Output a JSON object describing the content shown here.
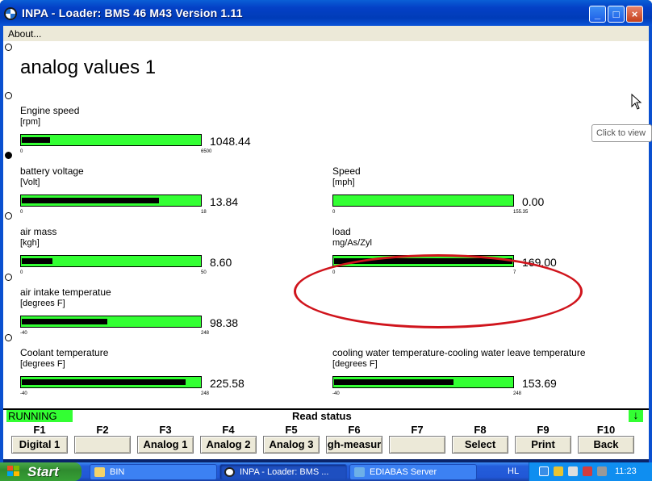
{
  "window": {
    "title": "INPA - Loader:  BMS 46 M43 Version 1.11",
    "minimize": "_",
    "maximize": "□",
    "close": "×"
  },
  "menu": {
    "about": "About..."
  },
  "heading": "analog values 1",
  "gauges": [
    {
      "name": "Engine speed",
      "unit": "[rpm]",
      "value": "1048.44",
      "min": "0",
      "max": "6500",
      "fill": 0.16
    },
    {
      "name": "battery voltage",
      "unit": "[Volt]",
      "value": "13.84",
      "min": "0",
      "max": "18",
      "fill": 0.77
    },
    {
      "name": "Speed",
      "unit": "[mph]",
      "value": "0.00",
      "min": "0",
      "max": "155.35",
      "fill": 0.0
    },
    {
      "name": "air mass",
      "unit": "[kgh]",
      "value": "8.60",
      "min": "0",
      "max": "50",
      "fill": 0.17
    },
    {
      "name": "load",
      "unit": "mg/As/Zyl",
      "value": "169.00",
      "min": "0",
      "max": "7",
      "fill": 1.0
    },
    {
      "name": "air intake temperatue",
      "unit": "[degrees F]",
      "value": "98.38",
      "min": "-40",
      "max": "248",
      "fill": 0.48
    },
    {
      "name": "Coolant temperature",
      "unit": "[degrees F]",
      "value": "225.58",
      "min": "-40",
      "max": "248",
      "fill": 0.92
    },
    {
      "name": "cooling water temperature-cooling water leave temperature",
      "unit": "[degrees F]",
      "value": "153.69",
      "min": "-40",
      "max": "248",
      "fill": 0.67
    }
  ],
  "tooltip": "Click to view",
  "status": {
    "running": "RUNNING",
    "read": "Read status",
    "arrow": "↓",
    "running_color": "#33ff33"
  },
  "fkeys": [
    {
      "key": "F1",
      "label": "Digital 1"
    },
    {
      "key": "F2",
      "label": ""
    },
    {
      "key": "F3",
      "label": "Analog 1"
    },
    {
      "key": "F4",
      "label": "Analog 2"
    },
    {
      "key": "F5",
      "label": "Analog 3"
    },
    {
      "key": "F6",
      "label": "gh-measur"
    },
    {
      "key": "F7",
      "label": ""
    },
    {
      "key": "F8",
      "label": "Select"
    },
    {
      "key": "F9",
      "label": "Print"
    },
    {
      "key": "F10",
      "label": "Back"
    }
  ],
  "taskbar": {
    "start": "Start",
    "tasks": [
      {
        "label": "BIN",
        "icon": "folder-icon"
      },
      {
        "label": "INPA - Loader:  BMS ...",
        "icon": "bmw-icon"
      },
      {
        "label": "EDIABAS Server",
        "icon": "server-icon"
      }
    ],
    "lang": "HL",
    "clock": "11:23"
  },
  "colors": {
    "gauge_green": "#33ff33",
    "gauge_fill": "#000000",
    "highlight_ellipse": "#d0141c",
    "titlebar": "#0440c6"
  }
}
